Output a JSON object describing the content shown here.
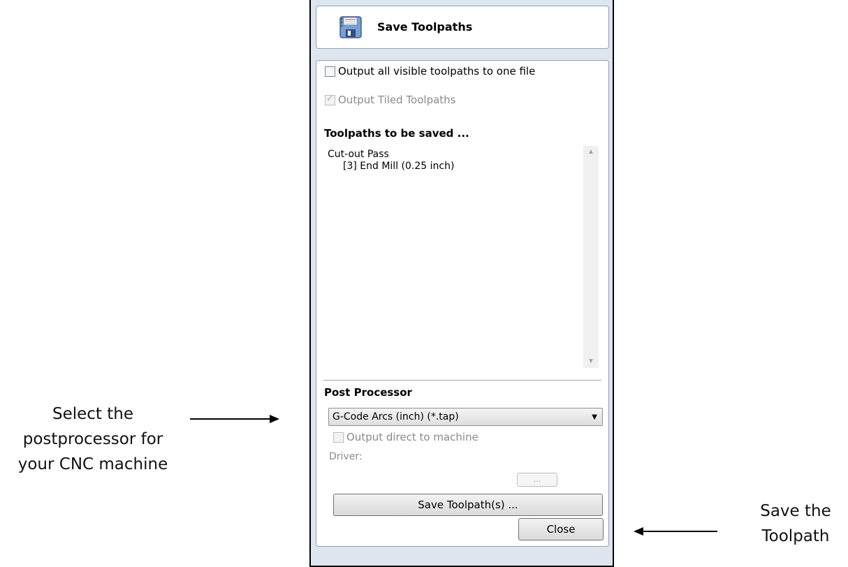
{
  "annotations": {
    "left_lines": [
      "Select the",
      "postprocessor for",
      "your CNC machine"
    ],
    "right_lines": [
      "Save the",
      "Toolpath"
    ]
  },
  "panel": {
    "title": "Save Toolpaths",
    "icon": "floppy-disk-icon",
    "options": {
      "output_one_file": {
        "label": "Output all visible toolpaths to one file",
        "checked": false,
        "enabled": true
      },
      "output_tiled": {
        "label": "Output Tiled Toolpaths",
        "checked": true,
        "enabled": false
      }
    },
    "toolpaths_heading": "Toolpaths to be saved ...",
    "toolpaths": [
      {
        "name": "Cut-out Pass",
        "tool": "[3] End Mill (0.25 inch)"
      }
    ],
    "post_processor": {
      "heading": "Post Processor",
      "selected": "G-Code Arcs (inch) (*.tap)",
      "output_direct": {
        "label": "Output direct to machine",
        "checked": false,
        "enabled": false
      },
      "driver_label": "Driver:",
      "browse_label": "..."
    },
    "save_button": "Save Toolpath(s) ...",
    "close_button": "Close"
  }
}
